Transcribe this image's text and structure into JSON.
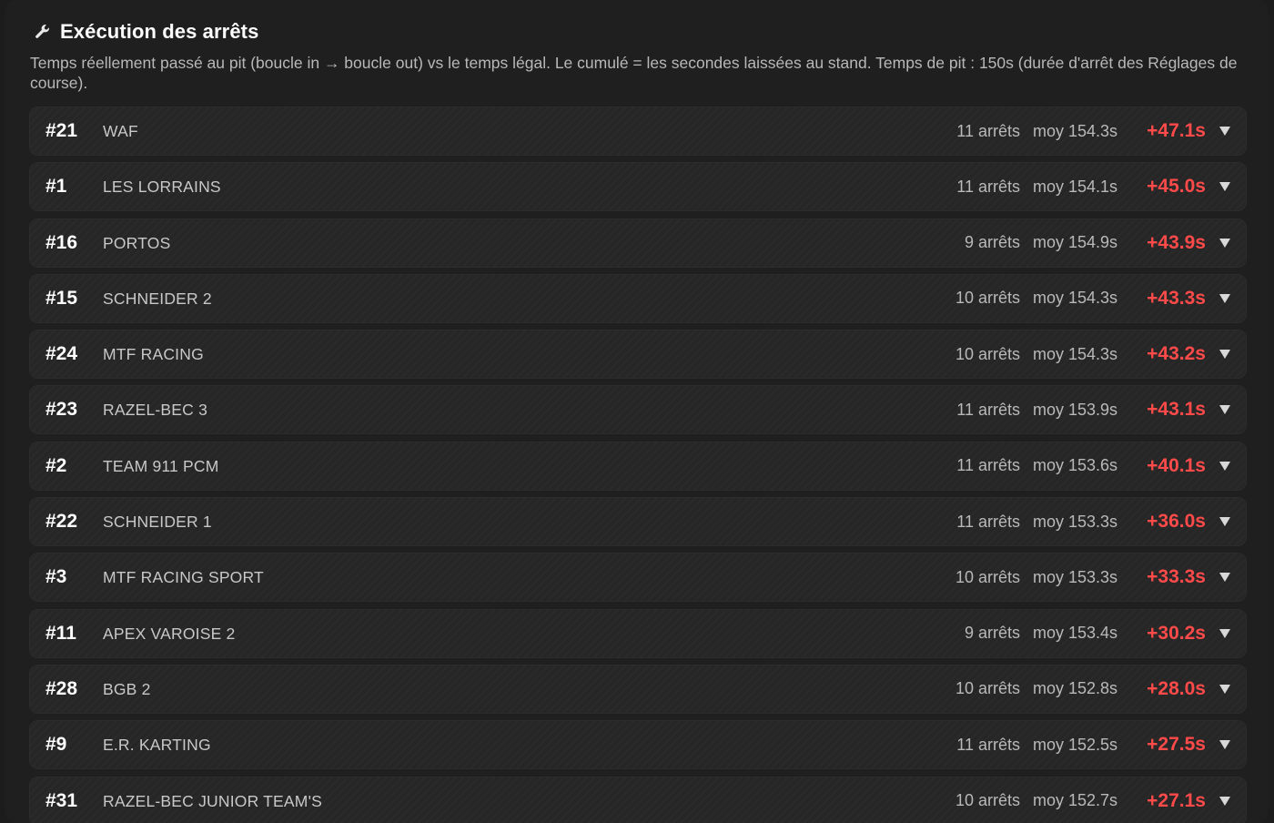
{
  "section": {
    "title": "Exécution des arrêts",
    "icon": "wrench-icon",
    "description": "Temps réellement passé au pit (boucle in → boucle out) vs le temps légal. Le cumulé = les secondes laissées au stand. Temps de pit : 150s (durée d'arrêt des Réglages de course)."
  },
  "colors": {
    "background": "#1c1c1c",
    "row_background": "#262626",
    "delta": "#ff4a4a",
    "text": "#ffffff",
    "muted": "#b9b9b9"
  },
  "rows": [
    {
      "num": "#21",
      "team": "WAF",
      "stops": "11 arrêts",
      "avg": "moy 154.3s",
      "delta": "+47.1s"
    },
    {
      "num": "#1",
      "team": "LES LORRAINS",
      "stops": "11 arrêts",
      "avg": "moy 154.1s",
      "delta": "+45.0s"
    },
    {
      "num": "#16",
      "team": "PORTOS",
      "stops": "9 arrêts",
      "avg": "moy 154.9s",
      "delta": "+43.9s"
    },
    {
      "num": "#15",
      "team": "SCHNEIDER 2",
      "stops": "10 arrêts",
      "avg": "moy 154.3s",
      "delta": "+43.3s"
    },
    {
      "num": "#24",
      "team": "MTF RACING",
      "stops": "10 arrêts",
      "avg": "moy 154.3s",
      "delta": "+43.2s"
    },
    {
      "num": "#23",
      "team": "RAZEL-BEC 3",
      "stops": "11 arrêts",
      "avg": "moy 153.9s",
      "delta": "+43.1s"
    },
    {
      "num": "#2",
      "team": "TEAM 911 PCM",
      "stops": "11 arrêts",
      "avg": "moy 153.6s",
      "delta": "+40.1s"
    },
    {
      "num": "#22",
      "team": "SCHNEIDER 1",
      "stops": "11 arrêts",
      "avg": "moy 153.3s",
      "delta": "+36.0s"
    },
    {
      "num": "#3",
      "team": "MTF RACING SPORT",
      "stops": "10 arrêts",
      "avg": "moy 153.3s",
      "delta": "+33.3s"
    },
    {
      "num": "#11",
      "team": "APEX VAROISE 2",
      "stops": "9 arrêts",
      "avg": "moy 153.4s",
      "delta": "+30.2s"
    },
    {
      "num": "#28",
      "team": "BGB 2",
      "stops": "10 arrêts",
      "avg": "moy 152.8s",
      "delta": "+28.0s"
    },
    {
      "num": "#9",
      "team": "E.R. KARTING",
      "stops": "11 arrêts",
      "avg": "moy 152.5s",
      "delta": "+27.5s"
    },
    {
      "num": "#31",
      "team": "RAZEL-BEC JUNIOR TEAM'S",
      "stops": "10 arrêts",
      "avg": "moy 152.7s",
      "delta": "+27.1s"
    }
  ]
}
